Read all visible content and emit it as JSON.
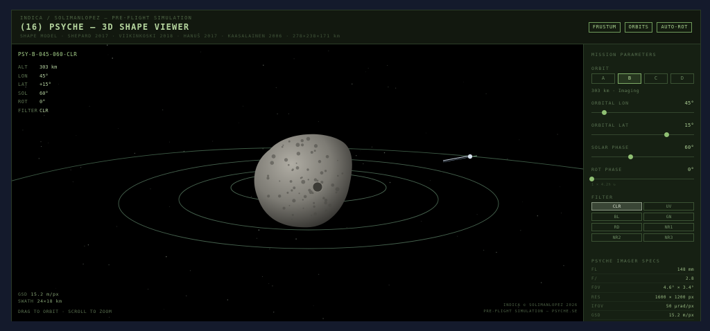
{
  "header": {
    "breadcrumb": "INDICA / SOLIMANLOPEZ — PRE-FLIGHT SIMULATION",
    "title": "(16) PSYCHE — 3D SHAPE VIEWER",
    "credits": "SHAPE MODEL · SHEPARD 2017 · VIIKINKOSKI 2018 · HANUŠ 2017 · KAASALAINEN 2006 · 278×238×171 km",
    "buttons": [
      "FRUSTUM",
      "ORBITS",
      "AUTO-ROT"
    ]
  },
  "telemetry": {
    "id": "PSY-B-045-060-CLR",
    "rows": [
      {
        "k": "ALT",
        "v": "303 km"
      },
      {
        "k": "LON",
        "v": "45°"
      },
      {
        "k": "LAT",
        "v": "+15°"
      },
      {
        "k": "SOL",
        "v": "60°"
      },
      {
        "k": "ROT",
        "v": "0°"
      },
      {
        "k": "FILTER",
        "v": "CLR"
      }
    ]
  },
  "bottom_left": {
    "gsd_label": "GSD",
    "gsd_value": "15.2 m/px",
    "swath_label": "SWATH",
    "swath_value": "24×18 km",
    "hint": "DRAG TO ORBIT · SCROLL TO ZOOM"
  },
  "bottom_right": {
    "line1": "INDICA © SOLIMANLOPEZ 2026",
    "line2": "PRE-FLIGHT SIMULATION — PSYCHE.SE"
  },
  "sidebar": {
    "mission_title": "MISSION PARAMETERS",
    "orbit_title": "ORBIT",
    "orbits": [
      {
        "label": "A",
        "active": false
      },
      {
        "label": "B",
        "active": true
      },
      {
        "label": "C",
        "active": false
      },
      {
        "label": "D",
        "active": false
      }
    ],
    "orbit_note": "303 km · Imaging",
    "sliders": [
      {
        "label": "ORBITAL LON",
        "value": "45°",
        "fraction": 0.125
      },
      {
        "label": "ORBITAL LAT",
        "value": "15°",
        "fraction": 0.735
      },
      {
        "label": "SOLAR PHASE",
        "value": "60°",
        "fraction": 0.38
      },
      {
        "label": "ROT PHASE",
        "value": "0°",
        "fraction": 0.0
      }
    ],
    "rot_note": "1 × 4.2h ↻",
    "filter_title": "FILTER",
    "filters": [
      {
        "label": "CLR",
        "active": true
      },
      {
        "label": "UV",
        "active": false
      },
      {
        "label": "BL",
        "active": false
      },
      {
        "label": "GN",
        "active": false
      },
      {
        "label": "RD",
        "active": false
      },
      {
        "label": "NR1",
        "active": false
      },
      {
        "label": "NR2",
        "active": false
      },
      {
        "label": "NR3",
        "active": false
      }
    ],
    "specs_title": "PSYCHE IMAGER SPECS",
    "specs": [
      {
        "k": "FL",
        "v": "148 mm"
      },
      {
        "k": "F/",
        "v": "2.8"
      },
      {
        "k": "FOV",
        "v": "4.6° × 3.4°"
      },
      {
        "k": "RES",
        "v": "1600 × 1200 px"
      },
      {
        "k": "IFOV",
        "v": "50 µrad/px"
      },
      {
        "k": "GSD",
        "v": "15.2 m/px"
      }
    ]
  },
  "colors": {
    "accent": "#9fc58a",
    "background": "#0b0d0a",
    "asteroid": "#8a8a84"
  }
}
